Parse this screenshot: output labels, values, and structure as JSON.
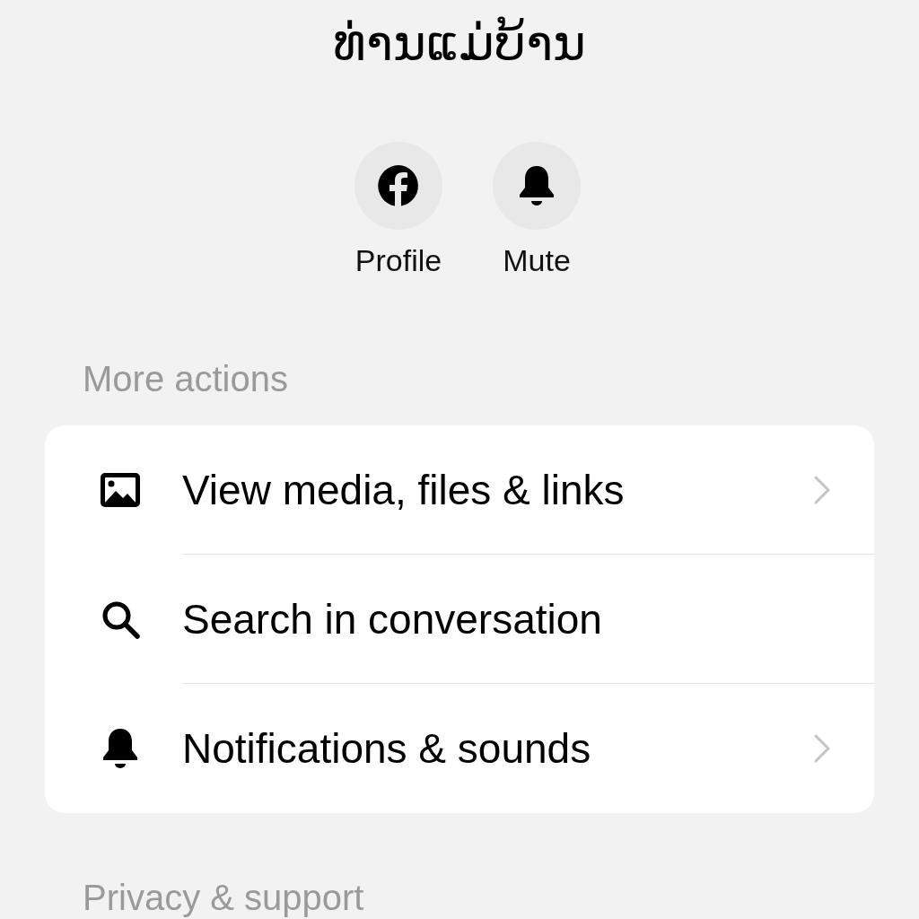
{
  "title": "ທ່ານແມ່ບ້ານ",
  "quick_actions": [
    {
      "label": "Profile"
    },
    {
      "label": "Mute"
    }
  ],
  "sections": [
    {
      "heading": "More actions",
      "items": [
        {
          "label": "View media, files & links",
          "chevron": true
        },
        {
          "label": "Search in conversation",
          "chevron": false
        },
        {
          "label": "Notifications & sounds",
          "chevron": true
        }
      ]
    },
    {
      "heading": "Privacy & support"
    }
  ]
}
